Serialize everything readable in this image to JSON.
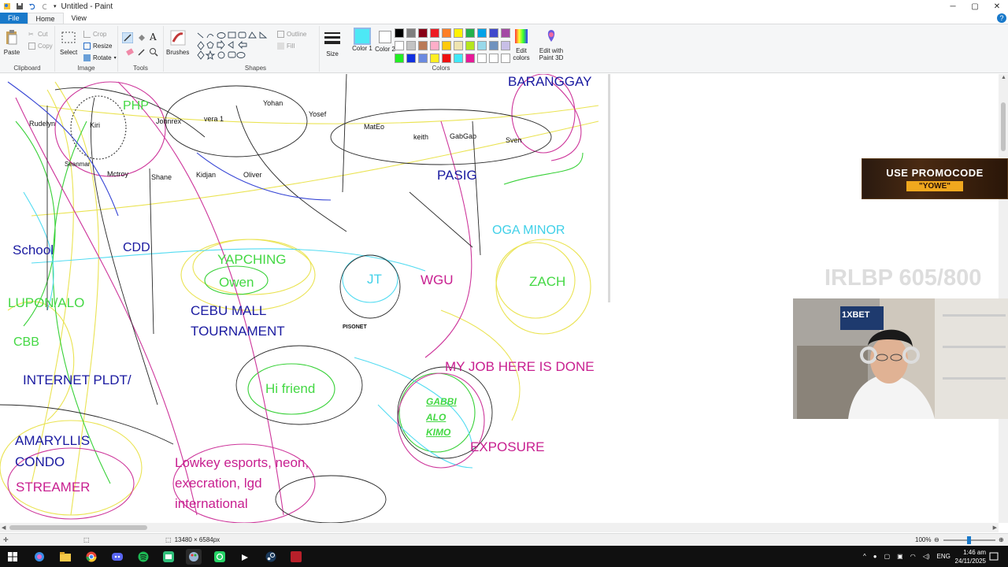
{
  "window": {
    "title": "Untitled - Paint",
    "controls": {
      "minimize": "─",
      "maximize": "▢",
      "close": "✕"
    }
  },
  "ribbon_tabs": [
    "File",
    "Home",
    "View"
  ],
  "ribbon": {
    "clipboard": {
      "paste": "Paste",
      "cut": "Cut",
      "copy": "Copy",
      "label": "Clipboard"
    },
    "image": {
      "select": "Select",
      "crop": "Crop",
      "resize": "Resize",
      "rotate": "Rotate",
      "label": "Image"
    },
    "tools": {
      "label": "Tools",
      "text_tool": "A"
    },
    "brushes": {
      "label": "Brushes"
    },
    "shapes": {
      "label": "Shapes",
      "outline": "Outline",
      "fill": "Fill"
    },
    "size": {
      "label": "Size"
    },
    "colors": {
      "color1_label": "Color 1",
      "color2_label": "Color 2",
      "color1_value": "#4de8f5",
      "color2_value": "#ffffff",
      "label": "Colors",
      "edit_colors": "Edit colors",
      "edit_paint3d": "Edit with Paint 3D",
      "palette": [
        "#000000",
        "#7f7f7f",
        "#880015",
        "#ed1c24",
        "#ff7f27",
        "#fff200",
        "#22b14c",
        "#00a2e8",
        "#3f48cc",
        "#a349a4",
        "#ffffff",
        "#c3c3c3",
        "#b97a57",
        "#ffaec9",
        "#ffc90e",
        "#efe4b0",
        "#b5e61d",
        "#99d9ea",
        "#7092be",
        "#c8bfe7",
        "#22ee22",
        "#1030e0",
        "#6a8ae0",
        "#ffee22",
        "#ee1010",
        "#40e8f8",
        "#e81898",
        "#ffffff",
        "#ffffff",
        "#ffffff"
      ]
    }
  },
  "canvas_text": {
    "barangay": "BARANGGAY",
    "php": "PHP",
    "rudelyn": "Rudelyn",
    "kiri": "Kiri",
    "johnrex": "Johnrex",
    "vera": "vera 1",
    "yohan": "Yohan",
    "yosef": "Yosef",
    "mateo": "MatEo",
    "keith": "keith",
    "gabgab": "GabGab",
    "sven": "Sven",
    "seanmar": "Seanmar",
    "mctroy": "Mctroy",
    "shane": "Shane",
    "kidjan": "Kidjan",
    "oliver": "Oliver",
    "pasig": "PASIG",
    "oga_minor": "OGA MINOR",
    "school": "School",
    "cdd": "CDD",
    "yapching": "YAPCHING",
    "owen": "Owen",
    "jt": "JT",
    "wgu": "WGU",
    "zach": "ZACH",
    "lupon": "LUPON/ALO",
    "cebu1": "CEBU MALL",
    "cebu2": "TOURNAMENT",
    "pisonet": "PISONET",
    "cbb": "CBB",
    "internet": "INTERNET PLDT/",
    "myjob": "MY JOB HERE IS DONE",
    "hifriend": "Hi friend",
    "gabbi": "GABBI",
    "alo": "ALO",
    "kimo": "KIMO",
    "amaryllis1": "AMARYLLIS",
    "amaryllis2": "CONDO",
    "exposure": "EXPOSURE",
    "lowkey1": "Lowkey esports, neon,",
    "lowkey2": "execration, lgd",
    "lowkey3": "international",
    "streamer": "STREAMER"
  },
  "status": {
    "canvas_size": "13480 × 6584px",
    "zoom": "100%"
  },
  "overlay": {
    "promo_line1": "USE PROMOCODE",
    "promo_line2": "\"YOWE\"",
    "watermark": "IRLBP 605/800",
    "webcam_brand": "1XBET"
  },
  "taskbar": {
    "lang": "ENG",
    "time": "1:46 am",
    "date": "24/11/2025"
  }
}
